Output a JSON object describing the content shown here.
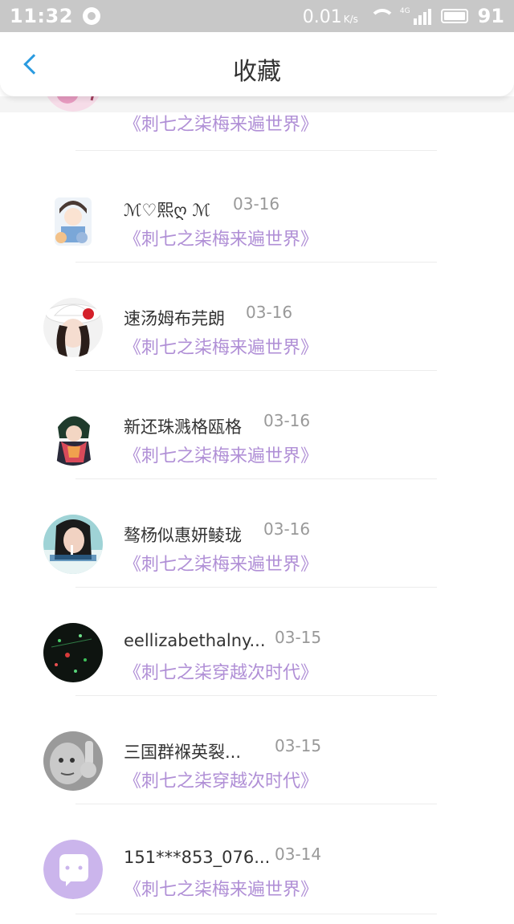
{
  "status_bar": {
    "time": "11:32",
    "speed": "0.01",
    "speed_unit": "K/s",
    "network": "4G",
    "battery": "91"
  },
  "header": {
    "title": "收藏"
  },
  "items": [
    {
      "name": "",
      "date": "",
      "book": "《刺七之柒梅来遍世界》",
      "avatar": "pink-floral-avatar"
    },
    {
      "name": "ℳ♡熙ღ ℳ",
      "date": "03-16",
      "book": "《刺七之柒梅来遍世界》",
      "avatar": "anime-boy-avatar"
    },
    {
      "name": "速汤姆布芫朗",
      "date": "03-16",
      "book": "《刺七之柒梅来遍世界》",
      "avatar": "hat-girl-avatar"
    },
    {
      "name": "新还珠溅格瓯格",
      "date": "03-16",
      "book": "《刺七之柒梅来遍世界》",
      "avatar": "anime-scarf-avatar"
    },
    {
      "name": "骜杨似惠妍鲮珑",
      "date": "03-16",
      "book": "《刺七之柒梅来遍世界》",
      "avatar": "girl-photo-avatar"
    },
    {
      "name": "eellizabethalny...",
      "date": "03-15",
      "book": "《刺七之柒穿越次时代》",
      "avatar": "dark-lights-avatar"
    },
    {
      "name": "三国群褓英裂...",
      "date": "03-15",
      "book": "《刺七之柒穿越次时代》",
      "avatar": "grey-baby-avatar"
    },
    {
      "name": "151***853_076...",
      "date": "03-14",
      "book": "《刺七之柒梅来遍世界》",
      "avatar": "default-chat-avatar"
    }
  ]
}
